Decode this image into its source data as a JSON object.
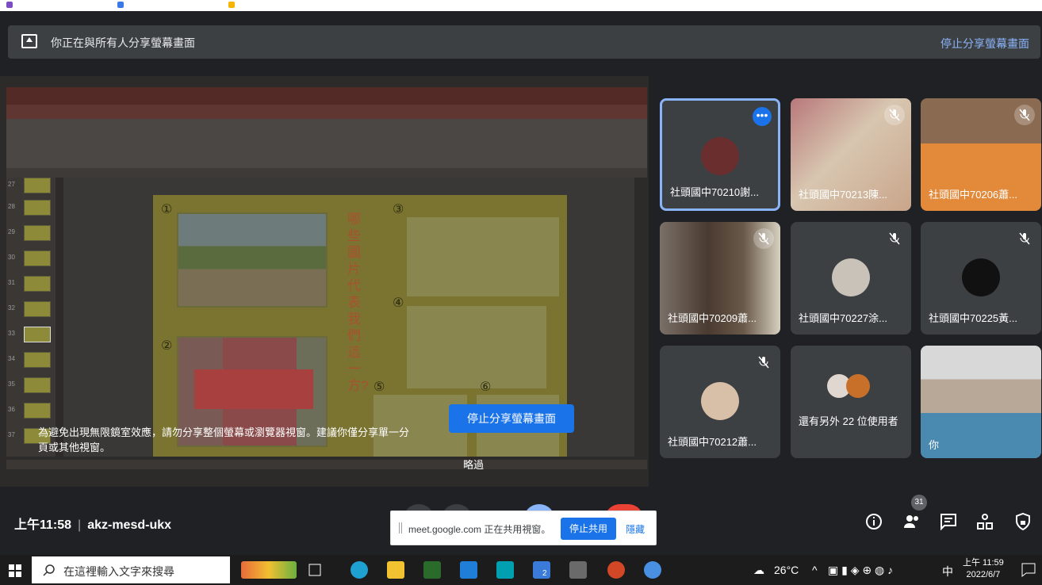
{
  "banner": {
    "message": "你正在與所有人分享螢幕畫面",
    "stop_link": "停止分享螢幕畫面"
  },
  "presentation": {
    "vertical_text": "哪些圖片代表我們這一方?",
    "slide_numbers": [
      "①",
      "②",
      "③",
      "④",
      "⑤",
      "⑥"
    ],
    "thumb_numbers": [
      "27",
      "28",
      "29",
      "30",
      "31",
      "32",
      "33",
      "34",
      "35",
      "36",
      "37"
    ],
    "warning": "為避免出現無限鏡室效應，請勿分享整個螢幕或瀏覽器視窗。建議你僅分享單一分頁或其他視窗。",
    "stop_button": "停止分享螢幕畫面",
    "skip": "略過"
  },
  "tiles": [
    {
      "name": "社頭國中70210謝...",
      "state": "more"
    },
    {
      "name": "社頭國中70213陳...",
      "state": "muted"
    },
    {
      "name": "社頭國中70206蕭...",
      "state": "muted"
    },
    {
      "name": "社頭國中70209蕭...",
      "state": "muted"
    },
    {
      "name": "社頭國中70227涂...",
      "state": "muted"
    },
    {
      "name": "社頭國中70225黃...",
      "state": "muted"
    },
    {
      "name": "社頭國中70212蕭...",
      "state": "muted"
    },
    {
      "name": "還有另外 22 位使用者",
      "state": "group"
    },
    {
      "name": "你",
      "state": "self"
    }
  ],
  "bottombar": {
    "time": "上午11:58",
    "meeting_code": "akz-mesd-ukx",
    "participant_count": "31"
  },
  "share_notice": {
    "text": "meet.google.com 正在共用視窗。",
    "stop": "停止共用",
    "hide": "隱藏"
  },
  "taskbar": {
    "search_placeholder": "在這裡輸入文字來搜尋",
    "temperature": "26°C",
    "ime": "中",
    "time": "上午 11:59",
    "date": "2022/6/7",
    "badge": "2"
  },
  "colors": {
    "accent": "#1a73e8",
    "link": "#8ab4f8",
    "background": "#202124",
    "tile": "#3c4043"
  }
}
